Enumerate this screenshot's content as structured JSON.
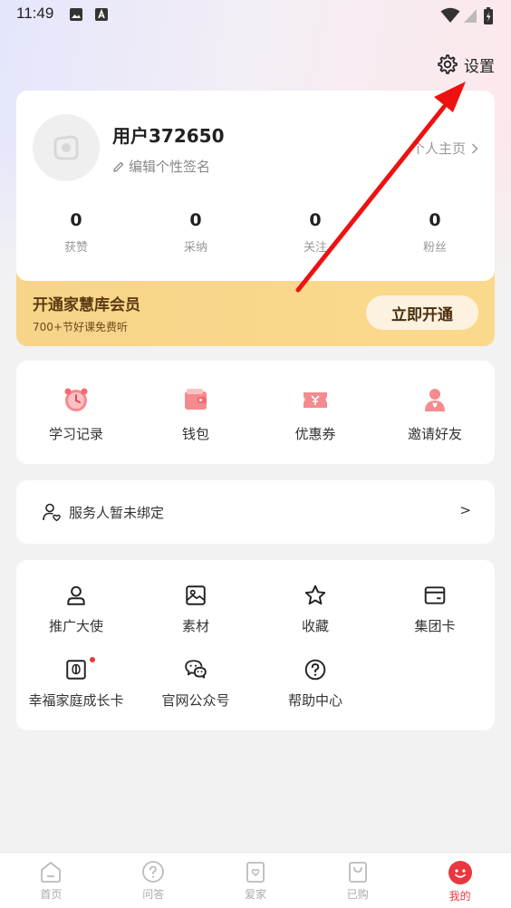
{
  "status_bar": {
    "time": "11:49"
  },
  "header": {
    "settings_label": "设置"
  },
  "profile": {
    "username": "用户372650",
    "signature": "编辑个性签名",
    "homepage_link": "个人主页",
    "stats": [
      {
        "value": "0",
        "label": "获赞"
      },
      {
        "value": "0",
        "label": "采纳"
      },
      {
        "value": "0",
        "label": "关注"
      },
      {
        "value": "0",
        "label": "粉丝"
      }
    ]
  },
  "vip": {
    "title": "开通家慧库会员",
    "subtitle": "700+节好课免费听",
    "button": "立即开通"
  },
  "quick_links": [
    {
      "label": "学习记录",
      "icon": "alarm-clock-icon"
    },
    {
      "label": "钱包",
      "icon": "wallet-icon"
    },
    {
      "label": "优惠券",
      "icon": "coupon-icon"
    },
    {
      "label": "邀请好友",
      "icon": "invite-friend-icon"
    }
  ],
  "service": {
    "text": "服务人暂未绑定",
    "arrow": ">"
  },
  "tools": [
    {
      "label": "推广大使",
      "icon": "person-icon"
    },
    {
      "label": "素材",
      "icon": "image-icon"
    },
    {
      "label": "收藏",
      "icon": "star-icon"
    },
    {
      "label": "集团卡",
      "icon": "card-icon"
    },
    {
      "label": "幸福家庭成长卡",
      "icon": "growth-card-icon"
    },
    {
      "label": "官网公众号",
      "icon": "wechat-icon"
    },
    {
      "label": "帮助中心",
      "icon": "help-icon"
    }
  ],
  "tabbar": [
    {
      "label": "首页",
      "icon": "home-icon"
    },
    {
      "label": "问答",
      "icon": "qa-icon"
    },
    {
      "label": "爱家",
      "icon": "heart-home-icon"
    },
    {
      "label": "已购",
      "icon": "bag-icon"
    },
    {
      "label": "我的",
      "icon": "profile-smile-icon",
      "active": true
    }
  ],
  "colors": {
    "accent": "#e8373f",
    "vip_gold": "#f9d68a",
    "quick_icon_pink": "#f58a8f"
  }
}
